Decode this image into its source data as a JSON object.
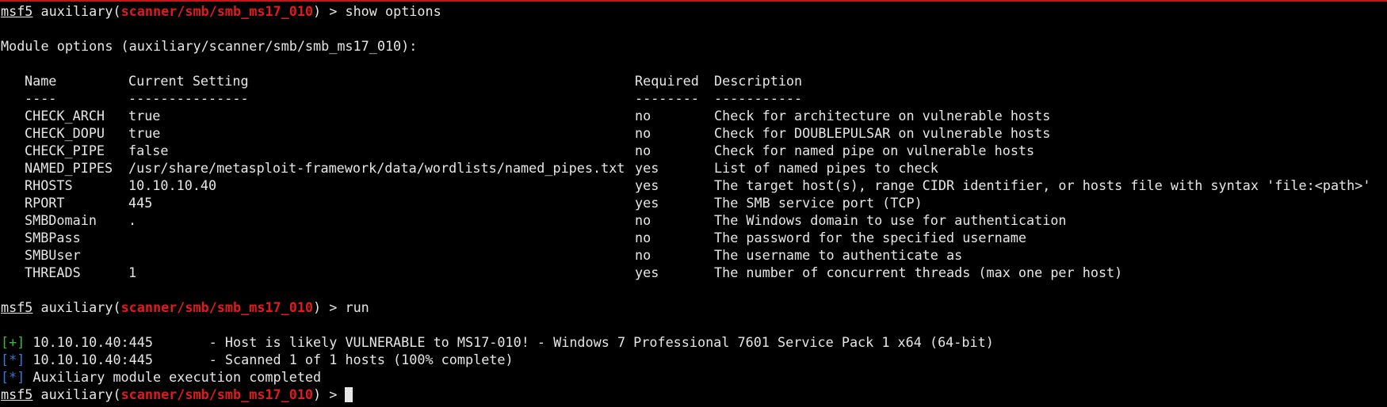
{
  "colors": {
    "background": "#000000",
    "text": "#e6e6e6",
    "module_path": "#e11b1b",
    "plus_marker": "#3db83d",
    "star_marker": "#3b78d4",
    "top_border": "#c4151c"
  },
  "prompt": {
    "label": "msf5",
    "context_prefix": " auxiliary(",
    "module": "scanner/smb/smb_ms17_010",
    "context_suffix": ") > "
  },
  "commands": {
    "first": "show options",
    "second": "run"
  },
  "module_options_heading": "Module options (auxiliary/scanner/smb/smb_ms17_010):",
  "table": {
    "headers": {
      "name": "Name",
      "setting": "Current Setting",
      "required": "Required",
      "description": "Description"
    },
    "separators": {
      "name": "----",
      "setting": "---------------",
      "required": "--------",
      "description": "-----------"
    },
    "rows": [
      {
        "name": "CHECK_ARCH",
        "setting": "true",
        "required": "no",
        "description": "Check for architecture on vulnerable hosts"
      },
      {
        "name": "CHECK_DOPU",
        "setting": "true",
        "required": "no",
        "description": "Check for DOUBLEPULSAR on vulnerable hosts"
      },
      {
        "name": "CHECK_PIPE",
        "setting": "false",
        "required": "no",
        "description": "Check for named pipe on vulnerable hosts"
      },
      {
        "name": "NAMED_PIPES",
        "setting": "/usr/share/metasploit-framework/data/wordlists/named_pipes.txt",
        "required": "yes",
        "description": "List of named pipes to check"
      },
      {
        "name": "RHOSTS",
        "setting": "10.10.10.40",
        "required": "yes",
        "description": "The target host(s), range CIDR identifier, or hosts file with syntax 'file:<path>'"
      },
      {
        "name": "RPORT",
        "setting": "445",
        "required": "yes",
        "description": "The SMB service port (TCP)"
      },
      {
        "name": "SMBDomain",
        "setting": ".",
        "required": "no",
        "description": "The Windows domain to use for authentication"
      },
      {
        "name": "SMBPass",
        "setting": "",
        "required": "no",
        "description": "The password for the specified username"
      },
      {
        "name": "SMBUser",
        "setting": "",
        "required": "no",
        "description": "The username to authenticate as"
      },
      {
        "name": "THREADS",
        "setting": "1",
        "required": "yes",
        "description": "The number of concurrent threads (max one per host)"
      }
    ]
  },
  "output": [
    {
      "marker": "[+]",
      "text": " 10.10.10.40:445       - Host is likely VULNERABLE to MS17-010! - Windows 7 Professional 7601 Service Pack 1 x64 (64-bit)"
    },
    {
      "marker": "[*]",
      "text": " 10.10.10.40:445       - Scanned 1 of 1 hosts (100% complete)"
    },
    {
      "marker": "[*]",
      "text": " Auxiliary module execution completed"
    }
  ]
}
